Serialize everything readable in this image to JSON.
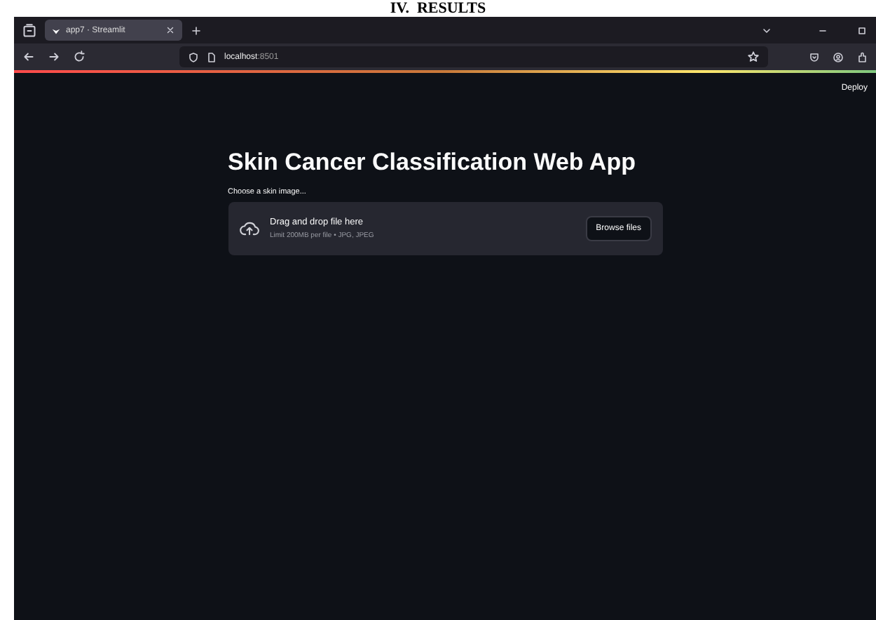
{
  "paper_heading": "IV.  RESULTS",
  "browser": {
    "tab": {
      "title": "app7 · Streamlit",
      "selected": true
    },
    "address": {
      "host": "localhost",
      "port": ":8501"
    }
  },
  "app": {
    "deploy": "Deploy",
    "title": "Skin Cancer Classification Web App",
    "uploader": {
      "label": "Choose a skin image...",
      "prompt": "Drag and drop file here",
      "limits": "Limit 200MB per file • JPG, JPEG",
      "button": "Browse files"
    }
  }
}
